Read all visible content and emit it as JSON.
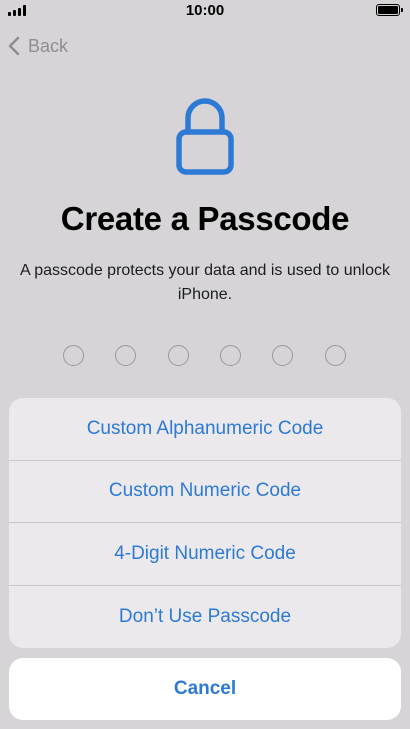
{
  "status_bar": {
    "time": "10:00"
  },
  "nav": {
    "back_label": "Back"
  },
  "header": {
    "title": "Create a Passcode",
    "subtitle": "A passcode protects your data and is used to unlock iPhone."
  },
  "passcode_dots": {
    "count": 6
  },
  "options": [
    {
      "label": "Custom Alphanumeric Code"
    },
    {
      "label": "Custom Numeric Code"
    },
    {
      "label": "4-Digit Numeric Code"
    },
    {
      "label": "Don’t Use Passcode"
    }
  ],
  "cancel_label": "Cancel",
  "colors": {
    "accent": "#2d7ad6",
    "background": "#d6d4d7",
    "sheet": "#ebe9ec"
  }
}
